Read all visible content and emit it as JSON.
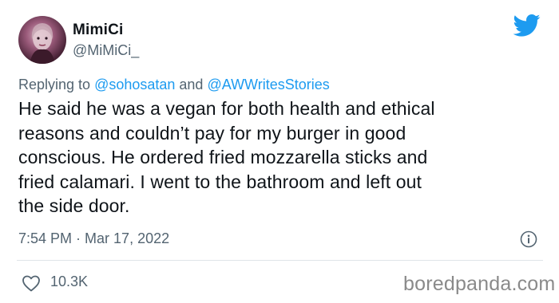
{
  "tweet": {
    "display_name": "MimiCi",
    "handle": "@MiMiCi_",
    "replying_prefix": "Replying to ",
    "reply_mention_1": "@sohosatan",
    "reply_and": " and ",
    "reply_mention_2": "@AWWritesStories",
    "lines": [
      "He said he was a vegan for both health and ethical",
      "reasons and couldn’t pay for my burger in good",
      "conscious. He ordered fried mozzarella sticks and",
      "fried calamari. I went to the bathroom and left out",
      "the side door."
    ],
    "time": "7:54 PM",
    "separator": " · ",
    "date": "Mar 17, 2022",
    "like_count": "10.3K"
  },
  "icons": {
    "logo": "twitter-bird-icon",
    "info": "info-icon",
    "like": "heart-icon"
  },
  "colors": {
    "accent": "#1d9bf0",
    "text": "#0f1419",
    "secondary_text": "#536471",
    "watermark": "#8a8a8a"
  },
  "watermark": "boredpanda.com"
}
